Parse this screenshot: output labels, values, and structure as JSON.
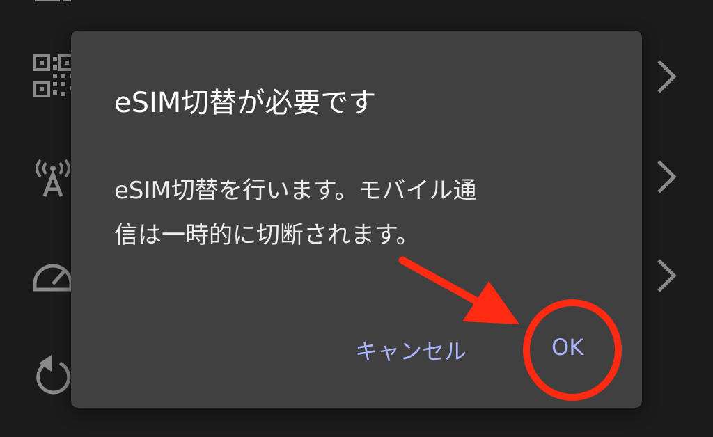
{
  "background": {
    "rows": [
      {
        "icon": "device-icon"
      },
      {
        "icon": "qr-code-icon"
      },
      {
        "icon": "signal-antenna-icon"
      },
      {
        "icon": "speedometer-icon"
      },
      {
        "icon": "reset-icon"
      }
    ]
  },
  "dialog": {
    "title": "eSIM切替が必要です",
    "message_line1": "eSIM切替を行います。モバイル通",
    "message_line2": "信は一時的に切断されます。",
    "cancel_label": "キャンセル",
    "ok_label": "OK"
  },
  "annotation": {
    "arrow_color": "#ff2a12",
    "circle_color": "#ff2a12"
  },
  "colors": {
    "background": "#1b1b1b",
    "dialog": "#404040",
    "button_text": "#aab4ff"
  }
}
